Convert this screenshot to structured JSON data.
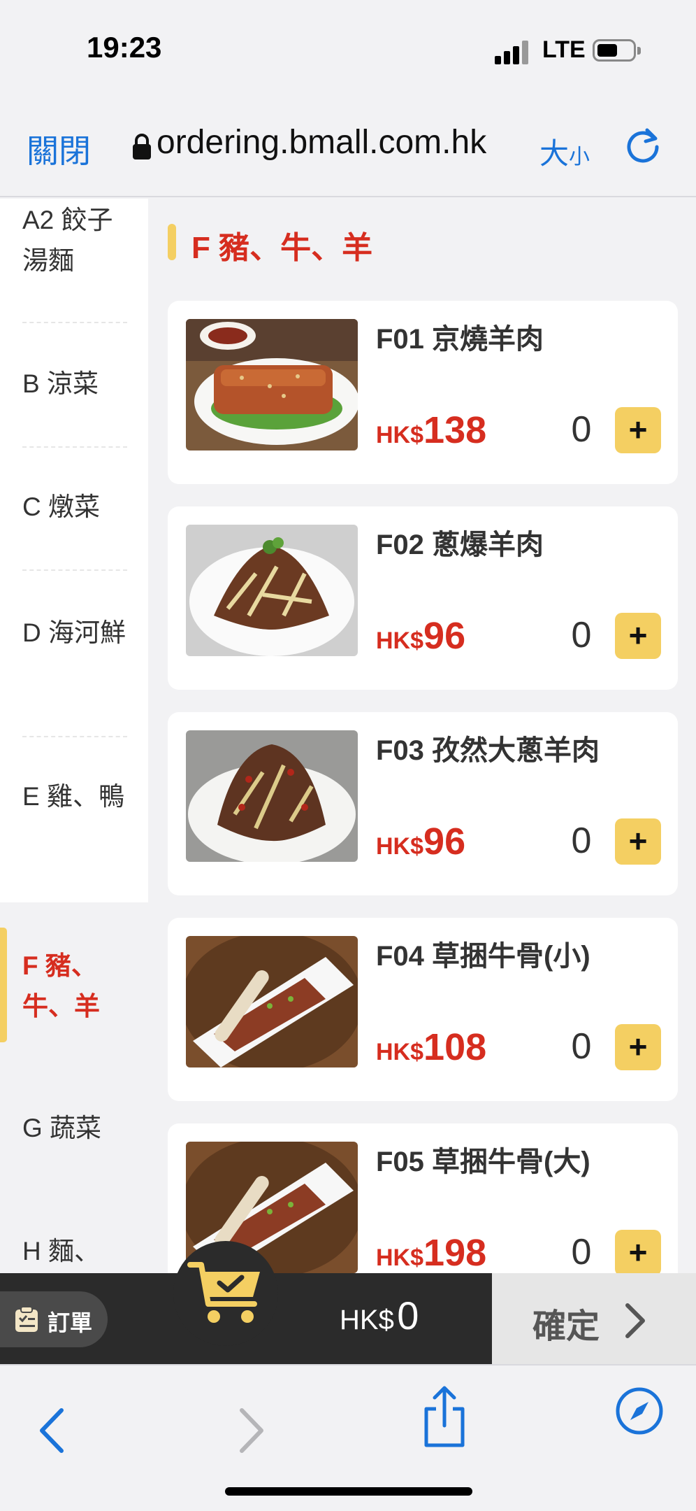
{
  "status_bar": {
    "time": "19:23",
    "network": "LTE"
  },
  "browser": {
    "close_label": "關閉",
    "url": "ordering.bmall.com.hk",
    "size_label_big": "大",
    "size_label_small": "小",
    "icons": [
      "lock-icon",
      "reload-icon",
      "back-icon",
      "forward-icon",
      "share-icon",
      "compass-icon"
    ]
  },
  "sidebar": {
    "items": [
      {
        "label": "A2 餃子湯麵"
      },
      {
        "label": "B 涼菜"
      },
      {
        "label": "C 燉菜"
      },
      {
        "label": "D 海河鮮"
      },
      {
        "label": "E 雞、鴨"
      },
      {
        "label": "F 豬、牛、羊",
        "active": true
      },
      {
        "label": "G 蔬菜"
      },
      {
        "label": "H 麵、"
      }
    ]
  },
  "section": {
    "title": "F 豬、牛、羊"
  },
  "dishes": [
    {
      "name": "F01 京燒羊肉",
      "currency": "HK$",
      "price": "138",
      "qty": "0",
      "add": "+"
    },
    {
      "name": "F02 蔥爆羊肉",
      "currency": "HK$",
      "price": "96",
      "qty": "0",
      "add": "+"
    },
    {
      "name": "F03 孜然大蔥羊肉",
      "currency": "HK$",
      "price": "96",
      "qty": "0",
      "add": "+"
    },
    {
      "name": "F04 草捆牛骨(小)",
      "currency": "HK$",
      "price": "108",
      "qty": "0",
      "add": "+"
    },
    {
      "name": "F05 草捆牛骨(大)",
      "currency": "HK$",
      "price": "198",
      "qty": "0",
      "add": "+"
    }
  ],
  "cart": {
    "orders_label": "訂單",
    "currency": "HK$",
    "total": "0",
    "confirm_label": "確定"
  },
  "colors": {
    "accent_red": "#d62d1f",
    "accent_yellow": "#f4cf62",
    "ios_blue": "#1a73d9",
    "cart_bar": "#2b2b2b"
  }
}
